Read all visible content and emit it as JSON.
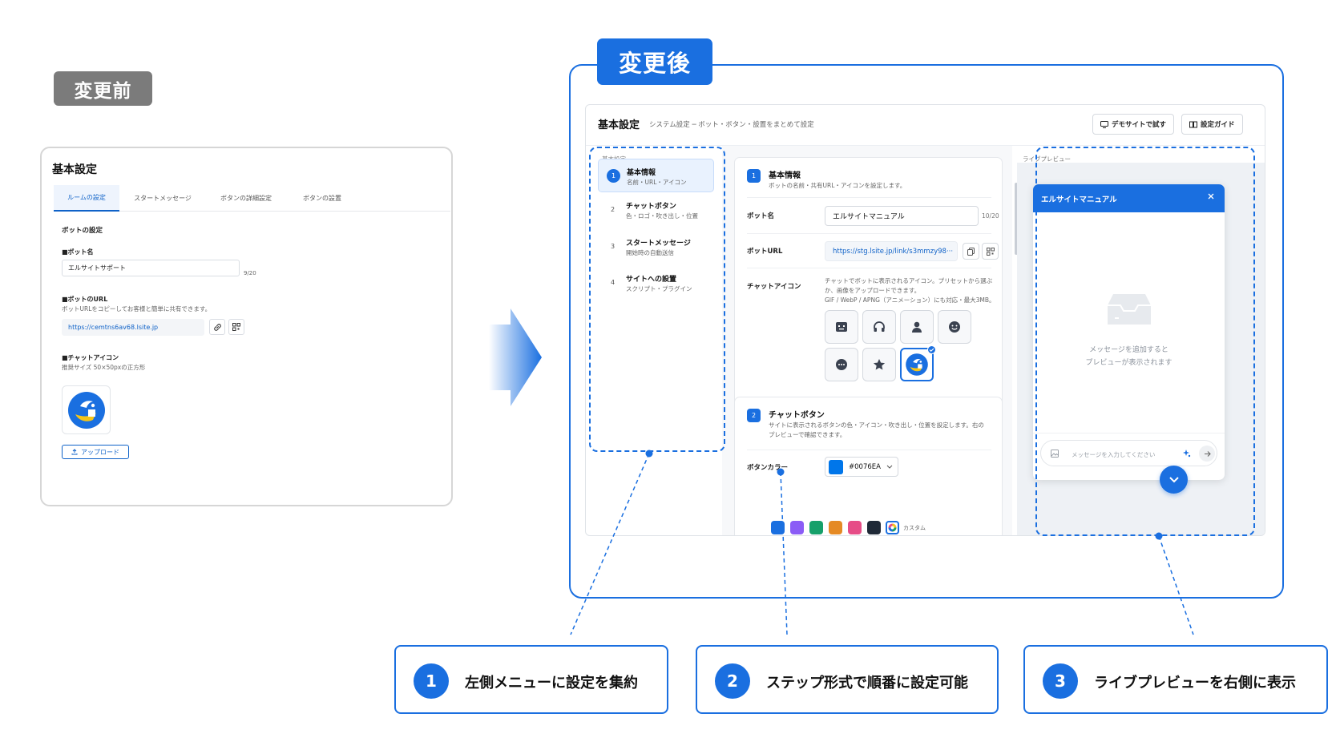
{
  "before": {
    "badge": "変更前",
    "title": "基本設定",
    "tabs": [
      "ルームの設定",
      "スタートメッセージ",
      "ボタンの詳細設定",
      "ボタンの設置"
    ],
    "section_title": "ボットの設定",
    "bot_name_label": "■ボット名",
    "bot_name_value": "エルサイトサポート",
    "bot_name_count": "9/20",
    "url_label": "■ボットのURL",
    "url_desc": "ボットURLをコピーしてお客様と簡単に共有できます。",
    "url_value": "https://cemtns6av68.lsite.jp",
    "icon_label": "■チャットアイコン",
    "icon_desc": "推奨サイズ 50×50pxの正方形",
    "upload_label": "アップロード"
  },
  "after": {
    "badge": "変更後",
    "title": "基本設定",
    "subtitle": "システム設定 ─ ボット・ボタン・設置をまとめて設定",
    "demo_button": "デモサイトで試す",
    "guide_button": "設定ガイド",
    "nav_heading": "基本設定",
    "steps": [
      {
        "num": "1",
        "title": "基本情報",
        "desc": "名前・URL・アイコン"
      },
      {
        "num": "2",
        "title": "チャットボタン",
        "desc": "色・ロゴ・吹き出し・位置"
      },
      {
        "num": "3",
        "title": "スタートメッセージ",
        "desc": "開始時の自動送信"
      },
      {
        "num": "4",
        "title": "サイトへの設置",
        "desc": "スクリプト・プラグイン"
      }
    ],
    "section1": {
      "num": "1",
      "title": "基本情報",
      "desc": "ボットの名前・共有URL・アイコンを設定します。",
      "bot_name_label": "ボット名",
      "bot_name_value": "エルサイトマニュアル",
      "bot_name_count": "10/20",
      "url_label": "ボットURL",
      "url_value": "https://stg.lsite.jp/link/s3mmzy98···",
      "icon_label": "チャットアイコン",
      "icon_desc": [
        "チャットでボットに表示されるアイコン。プリセットから選ぶ",
        "か、画像をアップロードできます。",
        "GIF / WebP / APNG（アニメーション）にも対応・最大3MB。"
      ],
      "icons": [
        "robot-icon",
        "headphones-icon",
        "person-icon",
        "smile-icon",
        "chat-bubble-icon",
        "star-icon",
        "brand-logo-icon"
      ]
    },
    "section2": {
      "num": "2",
      "title": "チャットボタン",
      "desc": [
        "サイトに表示されるボタンの色・アイコン・吹き出し・位置を設定します。右の",
        "プレビューで確認できます。"
      ],
      "color_label": "ボタンカラー",
      "color_value": "#0076EA",
      "custom_label": "カスタム",
      "swatches": [
        "#1a6fe0",
        "#8b5cf6",
        "#16a06a",
        "#e58a24",
        "#e64d87",
        "#1f2937"
      ]
    },
    "preview": {
      "heading": "ライブプレビュー",
      "window_title": "エルサイトマニュアル",
      "empty_text": [
        "メッセージを追加すると",
        "プレビューが表示されます"
      ],
      "input_placeholder": "メッセージを入力してください"
    }
  },
  "callouts": [
    {
      "num": "1",
      "text": "左側メニューに設定を集約"
    },
    {
      "num": "2",
      "text": "ステップ形式で順番に設定可能"
    },
    {
      "num": "3",
      "text": "ライブプレビューを右側に表示"
    }
  ],
  "colors": {
    "accent": "#1a6fe0",
    "before_badge": "#7b7b7b"
  }
}
